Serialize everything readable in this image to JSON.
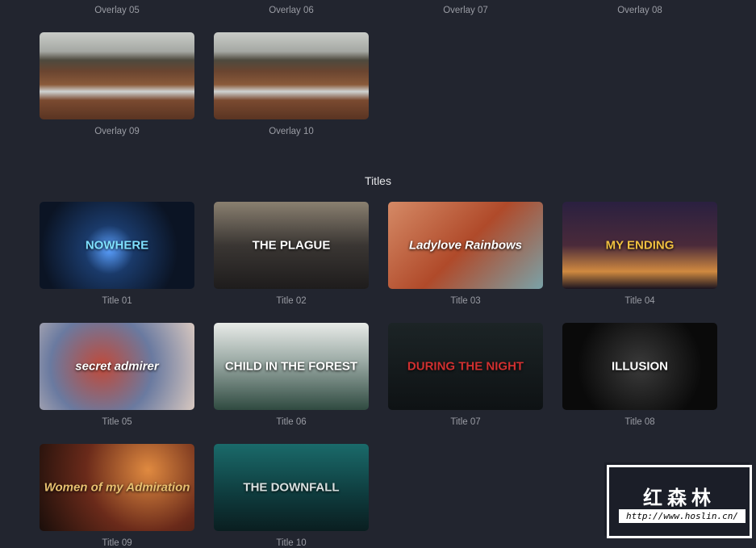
{
  "overlays": {
    "top_labels": [
      "Overlay 05",
      "Overlay 06",
      "Overlay 07",
      "Overlay 08"
    ],
    "items": [
      {
        "label": "Overlay 09"
      },
      {
        "label": "Overlay 10"
      }
    ]
  },
  "titles_section": {
    "heading": "Titles",
    "items": [
      {
        "label": "Title 01",
        "poster": "NOWHERE"
      },
      {
        "label": "Title 02",
        "poster": "THE PLAGUE"
      },
      {
        "label": "Title 03",
        "poster": "Ladylove Rainbows"
      },
      {
        "label": "Title 04",
        "poster": "MY ENDING"
      },
      {
        "label": "Title 05",
        "poster": "secret admirer"
      },
      {
        "label": "Title 06",
        "poster": "CHILD IN THE FOREST"
      },
      {
        "label": "Title 07",
        "poster": "DURING THE NIGHT"
      },
      {
        "label": "Title 08",
        "poster": "ILLUSION"
      },
      {
        "label": "Title 09",
        "poster": "Women of my Admiration"
      },
      {
        "label": "Title 10",
        "poster": "THE DOWNFALL"
      }
    ]
  },
  "watermark": {
    "text": "红森林",
    "url": "http://www.hoslin.cn/"
  }
}
